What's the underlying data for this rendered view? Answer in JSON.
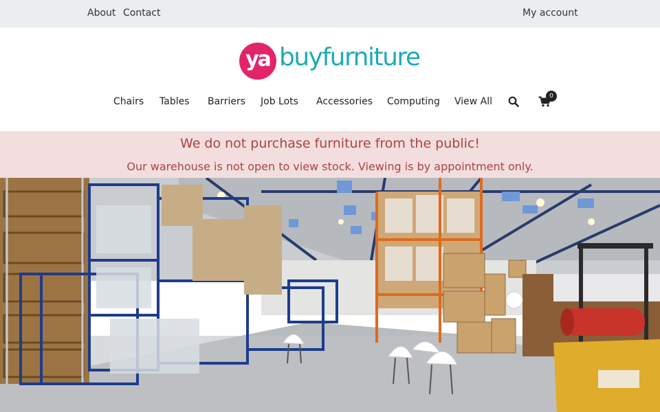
{
  "topbar": {
    "about": "About",
    "contact": "Contact",
    "my_account": "My account"
  },
  "logo": {
    "mark": "ya",
    "word": "buyfurniture",
    "mark_color": "#e2246b",
    "word_color": "#1eaab8"
  },
  "nav": {
    "items": [
      "Chairs",
      "Tables",
      "Barriers",
      "Job Lots",
      "Accessories",
      "Computing",
      "View All"
    ],
    "search_icon": "search-icon",
    "cart_icon": "cart-icon",
    "cart_count": "0"
  },
  "notice": {
    "line1": "We do not purchase furniture from the public!",
    "line2": "Our warehouse is not open to view stock. Viewing is by appointment only.",
    "bg_color": "#f2dede",
    "text_color": "#a94442"
  },
  "hero": {
    "icon": "warehouse-photo"
  }
}
